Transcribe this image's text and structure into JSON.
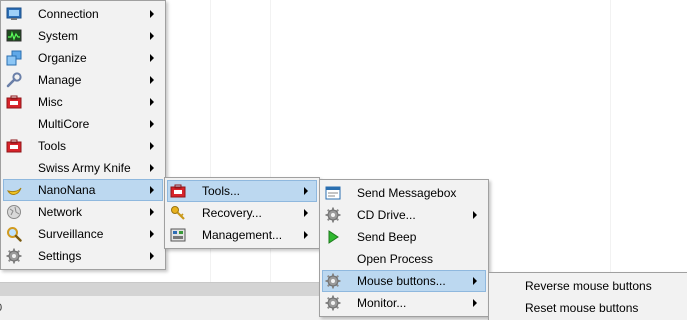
{
  "status": {
    "text": "0"
  },
  "main_menu": {
    "items": [
      {
        "label": "Connection",
        "icon": "monitor-icon"
      },
      {
        "label": "System",
        "icon": "system-monitor-icon"
      },
      {
        "label": "Organize",
        "icon": "windows-icon"
      },
      {
        "label": "Manage",
        "icon": "wrench-icon"
      },
      {
        "label": "Misc",
        "icon": "toolbox-icon"
      },
      {
        "label": "MultiCore",
        "icon": ""
      },
      {
        "label": "Tools",
        "icon": "toolbox-icon"
      },
      {
        "label": "Swiss Army Knife",
        "icon": ""
      },
      {
        "label": "NanoNana",
        "icon": "banana-icon"
      },
      {
        "label": "Network",
        "icon": "network-icon"
      },
      {
        "label": "Surveillance",
        "icon": "magnifier-icon"
      },
      {
        "label": "Settings",
        "icon": "gear-icon"
      }
    ]
  },
  "nanonana_menu": {
    "items": [
      {
        "label": "Tools...",
        "icon": "toolbox-icon"
      },
      {
        "label": "Recovery...",
        "icon": "key-icon"
      },
      {
        "label": "Management...",
        "icon": "panel-icon"
      }
    ]
  },
  "tools_menu": {
    "items": [
      {
        "label": "Send Messagebox",
        "icon": "messagebox-icon"
      },
      {
        "label": "CD Drive...",
        "icon": "gear-icon"
      },
      {
        "label": "Send Beep",
        "icon": "play-icon"
      },
      {
        "label": "Open Process",
        "icon": ""
      },
      {
        "label": "Mouse buttons...",
        "icon": "gear-icon"
      },
      {
        "label": "Monitor...",
        "icon": "gear-icon"
      }
    ]
  },
  "mouse_buttons_menu": {
    "items": [
      {
        "label": "Reverse mouse buttons"
      },
      {
        "label": "Reset mouse buttons"
      }
    ]
  },
  "colors": {
    "highlight": "#bcd8f0",
    "menu_background": "#f2f2f2",
    "menu_border": "#a0a0a0"
  }
}
